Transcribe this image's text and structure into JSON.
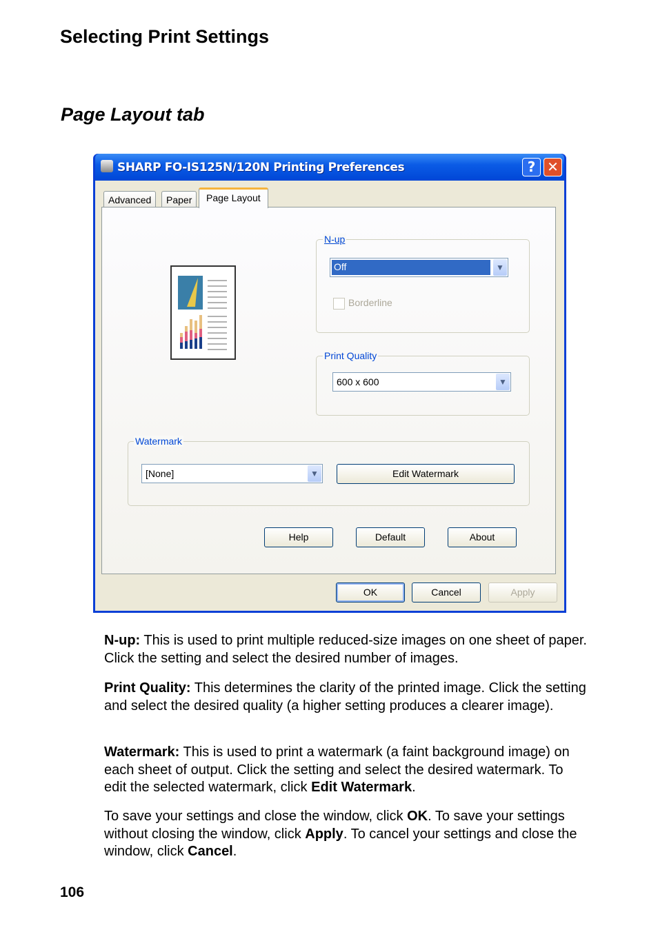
{
  "heading": "Selecting Print Settings",
  "subheading": "Page Layout tab",
  "dialog": {
    "title": "SHARP FO-IS125N/120N Printing Preferences",
    "help_icon": "?",
    "close_icon": "✕",
    "tabs": [
      {
        "label": "Advanced"
      },
      {
        "label": "Paper"
      },
      {
        "label": "Page Layout",
        "selected": true
      }
    ],
    "nup": {
      "label": "N-up",
      "value": "Off",
      "borderline": "Borderline",
      "borderline_checked": false,
      "borderline_enabled": false
    },
    "print_quality": {
      "label": "Print Quality",
      "value": "600 x 600"
    },
    "watermark": {
      "label": "Watermark",
      "value": "[None]",
      "edit_button": "Edit Watermark"
    },
    "buttons": {
      "help": "Help",
      "default": "Default",
      "about": "About",
      "ok": "OK",
      "cancel": "Cancel",
      "apply": "Apply"
    },
    "colors": {
      "title_bar": "#0b5ce6",
      "selection": "#316ac5",
      "face": "#ece9d8"
    }
  },
  "paragraphs": [
    {
      "term": "N-up:",
      "text": " This is used to print multiple reduced-size images on one sheet of paper. Click the setting and select the desired number of images."
    },
    {
      "term": "Print Quality:",
      "text": " This determines the clarity of the printed image. Click the setting and select the desired quality (a higher setting produces a clearer image)."
    },
    {
      "term": "Watermark:",
      "text": " This is used to print a watermark (a faint background image) on each sheet of output. Click the setting and select the desired watermark. To edit the selected watermark, click ",
      "b2": "Edit Watermark",
      "t2": "."
    },
    {
      "t0": "To save your settings and close the window, click ",
      "b0": "OK",
      "t1": ". To save your settings without closing the window, click ",
      "b1": "Apply",
      "t2": ". To cancel your settings and close the window, click ",
      "b2": "Cancel",
      "t3": "."
    }
  ],
  "page_number": "106"
}
